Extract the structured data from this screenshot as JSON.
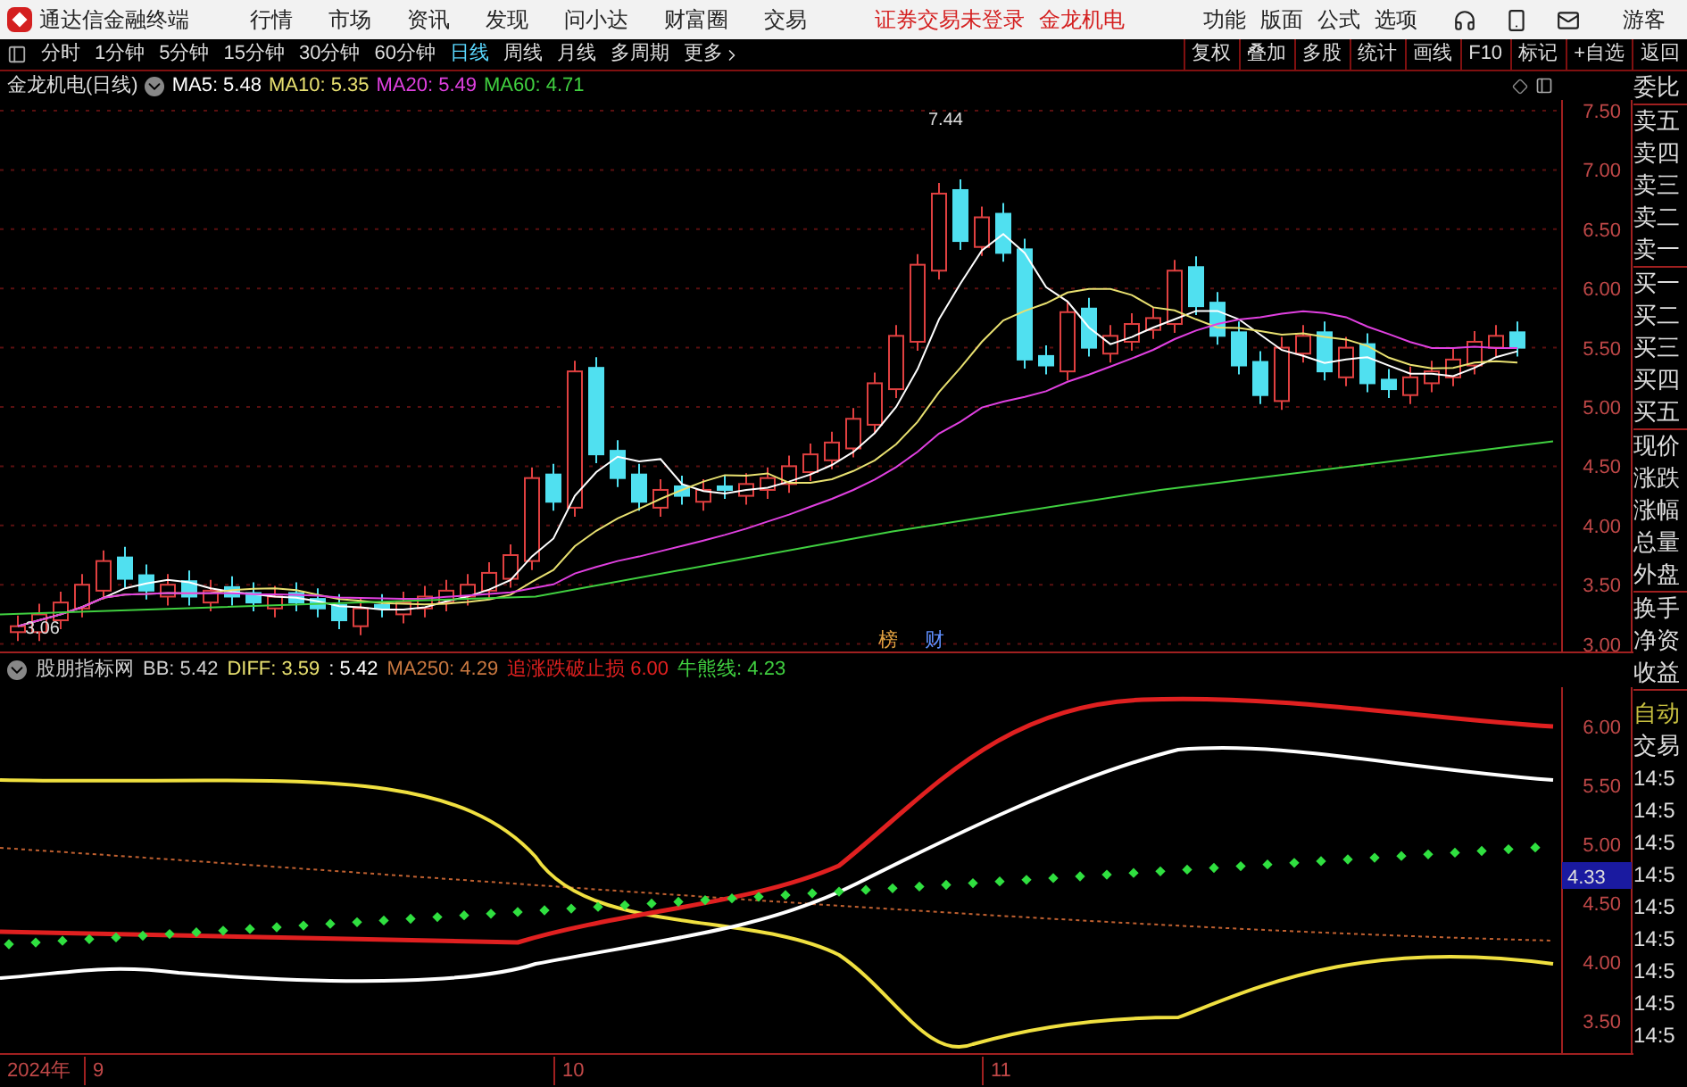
{
  "app": {
    "title": "通达信金融终端",
    "menu": [
      "行情",
      "市场",
      "资讯",
      "发现",
      "问小达",
      "财富圈",
      "交易"
    ],
    "status": "证券交易未登录",
    "stock": "金龙机电",
    "right_menu": [
      "功能",
      "版面",
      "公式",
      "选项"
    ],
    "user": "游客"
  },
  "periods": [
    {
      "label": "分时",
      "selected": false
    },
    {
      "label": "1分钟",
      "selected": false
    },
    {
      "label": "5分钟",
      "selected": false
    },
    {
      "label": "15分钟",
      "selected": false
    },
    {
      "label": "30分钟",
      "selected": false
    },
    {
      "label": "60分钟",
      "selected": false
    },
    {
      "label": "日线",
      "selected": true
    },
    {
      "label": "周线",
      "selected": false
    },
    {
      "label": "月线",
      "selected": false
    },
    {
      "label": "多周期",
      "selected": false
    },
    {
      "label": "更多",
      "selected": false
    }
  ],
  "tools": [
    "复权",
    "叠加",
    "多股",
    "统计",
    "画线",
    "F10",
    "标记",
    "+自选",
    "返回"
  ],
  "main_chart": {
    "title": "金龙机电(日线)",
    "ma": [
      {
        "label": "MA5: 5.48",
        "color": "#ffffff"
      },
      {
        "label": "MA10: 5.35",
        "color": "#e8e070"
      },
      {
        "label": "MA20: 5.49",
        "color": "#e040e0"
      },
      {
        "label": "MA60: 4.71",
        "color": "#40d040"
      }
    ],
    "yticks": [
      "7.50",
      "7.00",
      "6.50",
      "6.00",
      "5.50",
      "5.00",
      "4.50",
      "4.00",
      "3.50",
      "3.00"
    ],
    "high_label": "7.44",
    "low_label": "3.06",
    "markers": [
      "榜",
      "财"
    ]
  },
  "indicator": {
    "name": "股朋指标网",
    "values": [
      {
        "label": "BB: 5.42",
        "color": "#d0d0d0"
      },
      {
        "label": "DIFF: 3.59",
        "color": "#e8e070"
      },
      {
        "label": ": 5.42",
        "color": "#ffffff"
      },
      {
        "label": "MA250: 4.29",
        "color": "#c87840"
      },
      {
        "label": "追涨跌破止损 6.00",
        "color": "#e02020"
      },
      {
        "label": "牛熊线: 4.23",
        "color": "#40d040"
      }
    ],
    "yticks": [
      "6.00",
      "5.50",
      "5.00",
      "4.50",
      "4.00",
      "3.50"
    ],
    "current": "4.33"
  },
  "dates": [
    "2024年",
    "9",
    "10",
    "11"
  ],
  "quote_panel": {
    "groups": [
      [
        "委比"
      ],
      [
        "卖五",
        "卖四",
        "卖三",
        "卖二",
        "卖一"
      ],
      [
        "买一",
        "买二",
        "买三",
        "买四",
        "买五"
      ],
      [
        "现价",
        "涨跌",
        "涨幅",
        "总量",
        "外盘"
      ],
      [
        "换手",
        "净资",
        "收益"
      ]
    ]
  },
  "trade_panel": {
    "mode_label": "自动",
    "action_label": "交易",
    "times": [
      "14:5",
      "14:5",
      "14:5",
      "14:5",
      "14:5",
      "14:5",
      "14:5",
      "14:5",
      "14:5"
    ]
  }
}
